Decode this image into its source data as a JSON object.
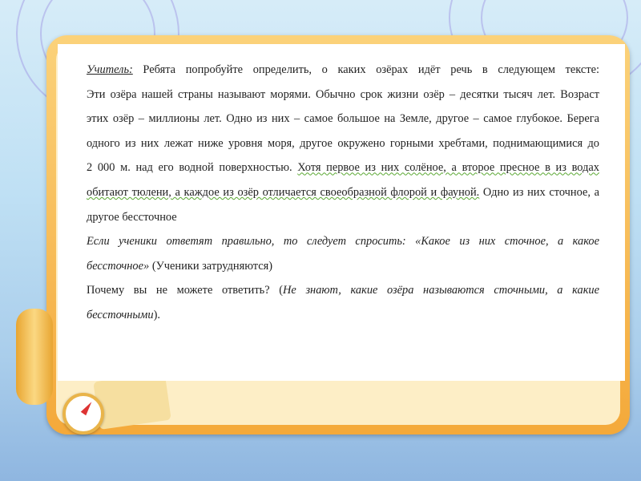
{
  "slide": {
    "lines": [
      [
        {
          "t": "Учитель:"
        },
        {
          "t": " Ребята попробуйте определить, о каких озёрах идёт речь в следующем тексте:"
        }
      ],
      [
        {
          "t": "Эти озёра нашей страны называют морями. Обычно срок жизни озёр – десятки тысяч лет. Возраст"
        }
      ],
      [
        {
          "t": "этих озёр – миллионы лет. Одно из них – самое большое на Земле, другое – самое глубокое. Берега"
        }
      ],
      [
        {
          "t": "одного из них лежат ниже уровня моря, другое окружено горными хребтами, поднимающимися до"
        }
      ],
      [
        {
          "t": "2 000 м. над его водной поверхностью. "
        },
        {
          "t": "Хотя первое из них солёное, а второе пресное в из водах"
        }
      ],
      [
        {
          "t": "обитают тюлени, а каждое из озёр отличается своеобразной флорой и фауной."
        },
        {
          "t": " Одно из них сточное, а"
        }
      ],
      [
        {
          "t": "другое бессточное"
        }
      ],
      [
        {
          "t": "Если ученики ответят правильно, то следует спросить: «Какое из них сточное, а какое"
        }
      ],
      [
        {
          "t": "бессточное»"
        },
        {
          "t": " (Ученики затрудняются)"
        }
      ],
      [
        {
          "t": "Почему вы не можете ответить? ("
        },
        {
          "t": "Не знают, какие озёра называются сточными, а какие"
        }
      ],
      [
        {
          "t": "бессточными"
        },
        {
          "t": ")."
        }
      ]
    ]
  },
  "colors": {
    "frame": "#f4a93a",
    "card": "#ffffff",
    "spellcheck": "#5aa832"
  }
}
